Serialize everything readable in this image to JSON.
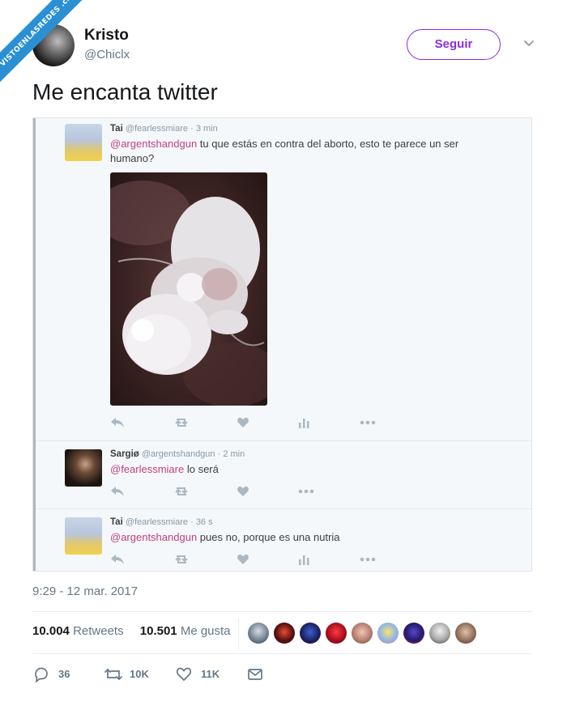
{
  "watermark": "VISTOENLASREDES .com",
  "author": {
    "name": "Kristo",
    "handle": "@Chiclx",
    "follow_label": "Seguir"
  },
  "tweet": {
    "text": "Me encanta twitter"
  },
  "embed": {
    "replies": [
      {
        "name": "Tai",
        "handle": "@fearlessmiare",
        "time": "· 3 min",
        "mention": "@argentshandgun",
        "text": " tu que estás en contra del aborto, esto te parece un ser humano?"
      },
      {
        "name": "Sargiø",
        "handle": "@argentshandgun",
        "time": "· 2 min",
        "mention": "@fearlessmiare",
        "text": " lo será"
      },
      {
        "name": "Tai",
        "handle": "@fearlessmiare",
        "time": "· 36 s",
        "mention": "@argentshandgun",
        "text": " pues no, porque es una nutria"
      }
    ]
  },
  "meta": {
    "timestamp": "9:29 - 12 mar. 2017"
  },
  "stats": {
    "retweets_count": "10.004",
    "retweets_label": "Retweets",
    "likes_count": "10.501",
    "likes_label": "Me gusta"
  },
  "actions": {
    "replies": "36",
    "retweets": "10K",
    "likes": "11K"
  },
  "colors": {
    "follow_accent": "#8a2be2",
    "mention": "#c13f7e",
    "ribbon": "#2a8fd3"
  },
  "icons": [
    "chevron-down-icon",
    "reply-icon",
    "retweet-icon",
    "heart-icon",
    "analytics-icon",
    "more-icon",
    "mail-icon"
  ]
}
